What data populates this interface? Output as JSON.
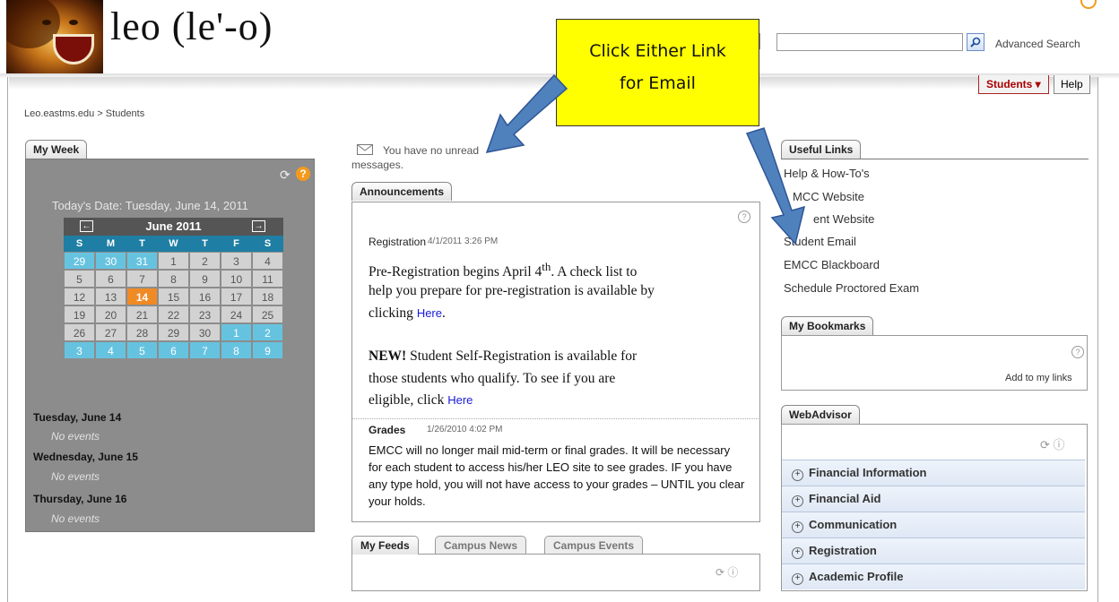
{
  "header": {
    "logo_text": "leo (le'-o)",
    "advanced_search": "Advanced Search",
    "search_placeholder": "",
    "students_menu": "Students ▾",
    "help": "Help"
  },
  "breadcrumb": "Leo.eastms.edu  > Students",
  "my_week": {
    "tab": "My Week",
    "today_label": "Today's Date:  Tuesday, June 14, 2011",
    "calendar": {
      "month": "June 2011",
      "prev": "←",
      "next": "→",
      "dow": [
        "S",
        "M",
        "T",
        "W",
        "T",
        "F",
        "S"
      ],
      "weeks": [
        [
          "29",
          "30",
          "31",
          "1",
          "2",
          "3",
          "4"
        ],
        [
          "5",
          "6",
          "7",
          "8",
          "9",
          "10",
          "11"
        ],
        [
          "12",
          "13",
          "14",
          "15",
          "16",
          "17",
          "18"
        ],
        [
          "19",
          "20",
          "21",
          "22",
          "23",
          "24",
          "25"
        ],
        [
          "26",
          "27",
          "28",
          "29",
          "30",
          "1",
          "2"
        ],
        [
          "3",
          "4",
          "5",
          "6",
          "7",
          "8",
          "9"
        ]
      ],
      "today": "14"
    },
    "events": [
      {
        "day": "Tuesday, June 14",
        "note": "No events"
      },
      {
        "day": "Wednesday, June 15",
        "note": "No events"
      },
      {
        "day": "Thursday, June 16",
        "note": "No events"
      }
    ]
  },
  "messages": {
    "text": "You have no unread messages."
  },
  "announcements": {
    "tab": "Announcements",
    "item1": {
      "title": "Registration",
      "date": "4/1/2011 3:26 PM",
      "line1": "Pre-Registration begins April 4",
      "sup": "th",
      "line1b": ".  A check list to",
      "line2": "help you prepare for pre-registration is available by",
      "line3": "clicking ",
      "link1": "Here",
      "line3b": ".",
      "new_label": "NEW!",
      "line4": "  Student Self-Registration is available for",
      "line5": "those students who qualify.  To see if you are",
      "line6": "eligible, click ",
      "link2": "Here"
    },
    "item2": {
      "title": "Grades",
      "date": "1/26/2010 4:02 PM",
      "body": "EMCC will no longer mail mid-term or final grades.  It will be necessary for each student to access his/her LEO site to see  grades.  IF you have any type hold, you will not have access to your grades – UNTIL you clear your holds."
    }
  },
  "feeds": {
    "tabs": [
      "My Feeds",
      "Campus News",
      "Campus Events"
    ]
  },
  "useful_links": {
    "tab": "Useful Links",
    "items": [
      "Help & How-To's",
      "EMCC Website",
      "Student Website",
      "Student Email",
      "EMCC Blackboard",
      "Schedule Proctored Exam"
    ],
    "visible": [
      "Help & How-To's",
      "MCC Website",
      "ent Website",
      "Student Email",
      "EMCC Blackboard",
      "Schedule Proctored Exam"
    ]
  },
  "bookmarks": {
    "tab": "My Bookmarks",
    "add": "Add to my links"
  },
  "webadvisor": {
    "tab": "WebAdvisor",
    "items": [
      "Financial Information",
      "Financial Aid",
      "Communication",
      "Registration",
      "Academic Profile"
    ]
  },
  "callout": {
    "line1": "Click Either Link",
    "line2": "for Email"
  },
  "colors": {
    "callout": "#ffff00",
    "arrow": "#4f81bd",
    "today": "#f08a24",
    "calendar_other": "#66c3e0"
  }
}
